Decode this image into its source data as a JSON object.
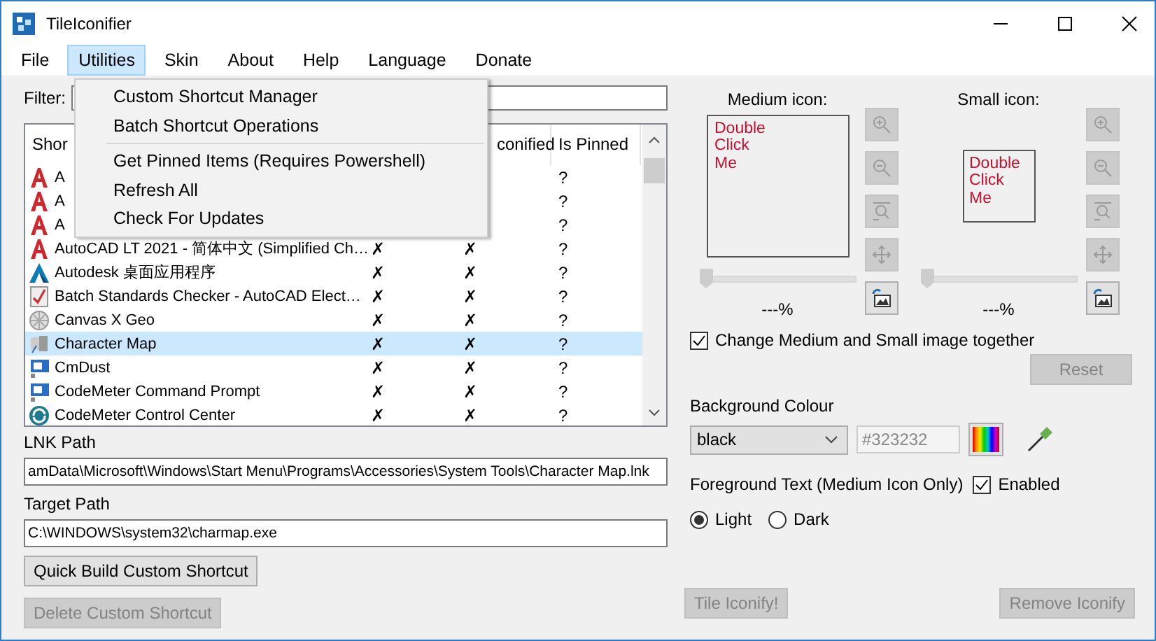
{
  "window": {
    "title": "TileIconifier"
  },
  "menu_bar": [
    {
      "label": "File",
      "selected": false
    },
    {
      "label": "Utilities",
      "selected": true
    },
    {
      "label": "Skin",
      "selected": false
    },
    {
      "label": "About",
      "selected": false
    },
    {
      "label": "Help",
      "selected": false
    },
    {
      "label": "Language",
      "selected": false
    },
    {
      "label": "Donate",
      "selected": false
    }
  ],
  "open_menu": {
    "sections": [
      [
        "Custom Shortcut Manager",
        "Batch Shortcut Operations"
      ],
      [
        "Get Pinned Items (Requires Powershell)",
        "Refresh All",
        "Check For Updates"
      ]
    ]
  },
  "filter": {
    "label": "Filter:"
  },
  "table": {
    "columns": {
      "column_1": "Shor",
      "column_3": "conified",
      "column_4": "Is Pinned"
    },
    "rows": [
      {
        "kind": "autocad",
        "name": "A",
        "column_4": "?",
        "selected": false
      },
      {
        "kind": "autocad",
        "name": "A",
        "column_4": "?",
        "selected": false
      },
      {
        "kind": "autocad",
        "name": "A",
        "column_4": "?",
        "selected": false
      },
      {
        "kind": "autocad",
        "name": "AutoCAD LT 2021 - 简体中文 (Simplified Ch…",
        "column_2": "✗",
        "column_3": "✗",
        "column_4": "?",
        "selected": false
      },
      {
        "kind": "autodesk",
        "name": "Autodesk 桌面应用程序",
        "column_2": "✗",
        "column_3": "✗",
        "column_4": "?",
        "selected": false
      },
      {
        "kind": "checker",
        "name": "Batch Standards Checker - AutoCAD Elect…",
        "column_2": "✗",
        "column_3": "✗",
        "column_4": "?",
        "selected": false
      },
      {
        "kind": "canvas",
        "name": "Canvas X Geo",
        "column_2": "✗",
        "column_3": "✗",
        "column_4": "?",
        "selected": false
      },
      {
        "kind": "charmap",
        "name": "Character Map",
        "column_2": "✗",
        "column_3": "✗",
        "column_4": "?",
        "selected": true
      },
      {
        "kind": "codemeter",
        "name": "CmDust",
        "column_2": "✗",
        "column_3": "✗",
        "column_4": "?",
        "selected": false
      },
      {
        "kind": "codemeter",
        "name": "CodeMeter Command Prompt",
        "column_2": "✗",
        "column_3": "✗",
        "column_4": "?",
        "selected": false
      },
      {
        "kind": "control",
        "name": "CodeMeter Control Center",
        "column_2": "✗",
        "column_3": "✗",
        "column_4": "?",
        "selected": false
      }
    ]
  },
  "lnk_path": {
    "label": "LNK Path",
    "value": "amData\\Microsoft\\Windows\\Start Menu\\Programs\\Accessories\\System Tools\\Character Map.lnk"
  },
  "target_path": {
    "label": "Target Path",
    "value": "C:\\WINDOWS\\system32\\charmap.exe"
  },
  "left_buttons": [
    {
      "label": "Quick Build Custom Shortcut",
      "disabled": false
    },
    {
      "label": "Delete Custom Shortcut",
      "disabled": true
    }
  ],
  "icons": [
    {
      "kind": "medium",
      "label": "Medium icon:",
      "preview": "Double\nClick\nMe",
      "level": 0,
      "percent": "---%",
      "tools": [
        {
          "kind": "zoom-in",
          "disabled": true
        },
        {
          "kind": "zoom-out",
          "disabled": true
        },
        {
          "kind": "zoom-fit",
          "disabled": true
        },
        {
          "kind": "move",
          "disabled": true
        },
        {
          "kind": "swap-image",
          "disabled": false
        }
      ]
    },
    {
      "kind": "small",
      "label": "Small icon:",
      "preview": "Double\nClick\nMe",
      "level": 0,
      "percent": "---%",
      "tools": [
        {
          "kind": "zoom-in",
          "disabled": true
        },
        {
          "kind": "zoom-out",
          "disabled": true
        },
        {
          "kind": "zoom-fit",
          "disabled": true
        },
        {
          "kind": "move",
          "disabled": true
        },
        {
          "kind": "swap-image",
          "disabled": false
        }
      ]
    }
  ],
  "together": {
    "label": "Change Medium and Small image together",
    "checked": true
  },
  "reset_button": {
    "label": "Reset",
    "disabled": true
  },
  "background_colour": {
    "label": "Background Colour",
    "select_value": "black",
    "hex": "#323232",
    "hex_disabled": true
  },
  "foreground": {
    "label": "Foreground Text (Medium Icon Only)",
    "enabled": {
      "label": "Enabled",
      "checked": true
    },
    "options": [
      {
        "label": "Light",
        "selected": true
      },
      {
        "label": "Dark",
        "selected": false
      }
    ]
  },
  "bottom_buttons": [
    {
      "label": "Tile Iconify!",
      "disabled": true
    },
    {
      "label": "Remove Iconify",
      "disabled": true
    }
  ]
}
